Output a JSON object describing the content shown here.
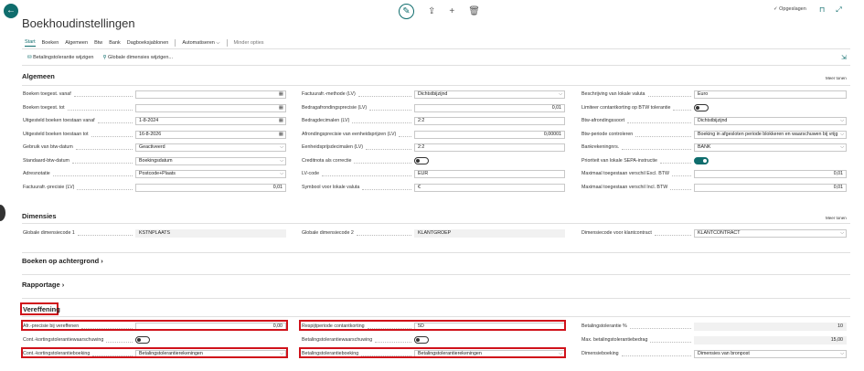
{
  "header": {
    "back_icon": "arrow-left-icon",
    "title": "Boekhoudinstellingen",
    "saved": "✓ Opgeslagen"
  },
  "tabs": [
    "Start",
    "Boeken",
    "Algemeen",
    "Btw",
    "Bank",
    "Dagboeksjablonen",
    "Automatiseren",
    "Minder opties"
  ],
  "actions": [
    "Betalingstolerantie wijzigen",
    "Globale dimensies wijzigen..."
  ],
  "algemeen": {
    "title": "Algemeen",
    "more": "Meer tonen",
    "col1": [
      {
        "label": "Boeken toegest. vanaf",
        "value": ""
      },
      {
        "label": "Boeken toegest. tot",
        "value": ""
      },
      {
        "label": "Uitgesteld boeken toestaan vanaf",
        "value": "1-8-2024"
      },
      {
        "label": "Uitgesteld boeken toestaan tot",
        "value": "16-8-2026"
      },
      {
        "label": "Gebruik van btw-datum",
        "value": "Geactiveerd"
      },
      {
        "label": "Standaard-btw-datum",
        "value": "Boekingsdatum"
      },
      {
        "label": "Adresnotatie",
        "value": "Postcode+Plaats"
      },
      {
        "label": "Factuurafr.-precisie (LV)",
        "value": "0,01"
      }
    ],
    "col2": [
      {
        "label": "Factuurafr.-methode (LV)",
        "value": "Dichtstbijzijnd"
      },
      {
        "label": "Bedragafrondingsprecisie (LV)",
        "value": "0,01"
      },
      {
        "label": "Bedragdecimalen (LV)",
        "value": "2:2"
      },
      {
        "label": "Afrondingsprecisie van eenheidsprijzen (LV)",
        "value": "0,00001"
      },
      {
        "label": "Eenheidsprijsdecimalen (LV)",
        "value": "2:2"
      },
      {
        "label": "Creditnota als correctie",
        "value": ""
      },
      {
        "label": "LV-code",
        "value": "EUR"
      },
      {
        "label": "Symbool voor lokale valuta",
        "value": "€"
      }
    ],
    "col3": [
      {
        "label": "Beschrijving van lokale valuta",
        "value": "Euro"
      },
      {
        "label": "Limiteer contantkorting op BTW tolerantie",
        "value": ""
      },
      {
        "label": "Btw-afrondingssoort",
        "value": "Dichtstbijzijnd"
      },
      {
        "label": "Btw-periode controleren",
        "value": "Boeking in afgesloten periode blokkeren en waarschuwen bij vrijg"
      },
      {
        "label": "Bankrekeningnrs.",
        "value": "BANK"
      },
      {
        "label": "Prioriteit van lokale SEPA-instructie",
        "value": ""
      },
      {
        "label": "Maximaal toegestaan verschil Excl. BTW",
        "value": "0,01"
      },
      {
        "label": "Maximaal toegestaan verschil Incl. BTW",
        "value": "0,01"
      }
    ]
  },
  "dimensies": {
    "title": "Dimensies",
    "more": "Meer tonen",
    "items": [
      {
        "label": "Globale dimensiecode 1",
        "value": "KSTNPLAATS"
      },
      {
        "label": "Globale dimensiecode 2",
        "value": "KLANTGROEP"
      },
      {
        "label": "Dimensiecode voor klantcontract",
        "value": "KLANTCONTRACT"
      }
    ]
  },
  "boeken_achtergrond": {
    "title": "Boeken op achtergrond"
  },
  "rapportage": {
    "title": "Rapportage"
  },
  "vereffening": {
    "title": "Vereffening",
    "col1": [
      {
        "label": "Afr.-precisie bij vereffenen",
        "value": "0,00"
      },
      {
        "label": "Cont.-kortingstolerantiewaarschuwing",
        "value": ""
      },
      {
        "label": "Cont.-kortingstolerantieboeking",
        "value": "Betalingstolerantierekeningen"
      }
    ],
    "col2": [
      {
        "label": "Respijtperiode contantkorting",
        "value": "5D"
      },
      {
        "label": "Betalingstolerantiewaarschuwing",
        "value": ""
      },
      {
        "label": "Betalingstolerantieboeking",
        "value": "Betalingstolerantierekeningen"
      }
    ],
    "col3": [
      {
        "label": "Betalingstolerantie %",
        "value": "10"
      },
      {
        "label": "Max. betalingstolerantiebedrag",
        "value": "15,00"
      },
      {
        "label": "Dimensieboeking",
        "value": "Dimensies van bronpost"
      }
    ]
  },
  "colors": {
    "accent": "#0f6d6d",
    "highlight": "#d0121b"
  }
}
